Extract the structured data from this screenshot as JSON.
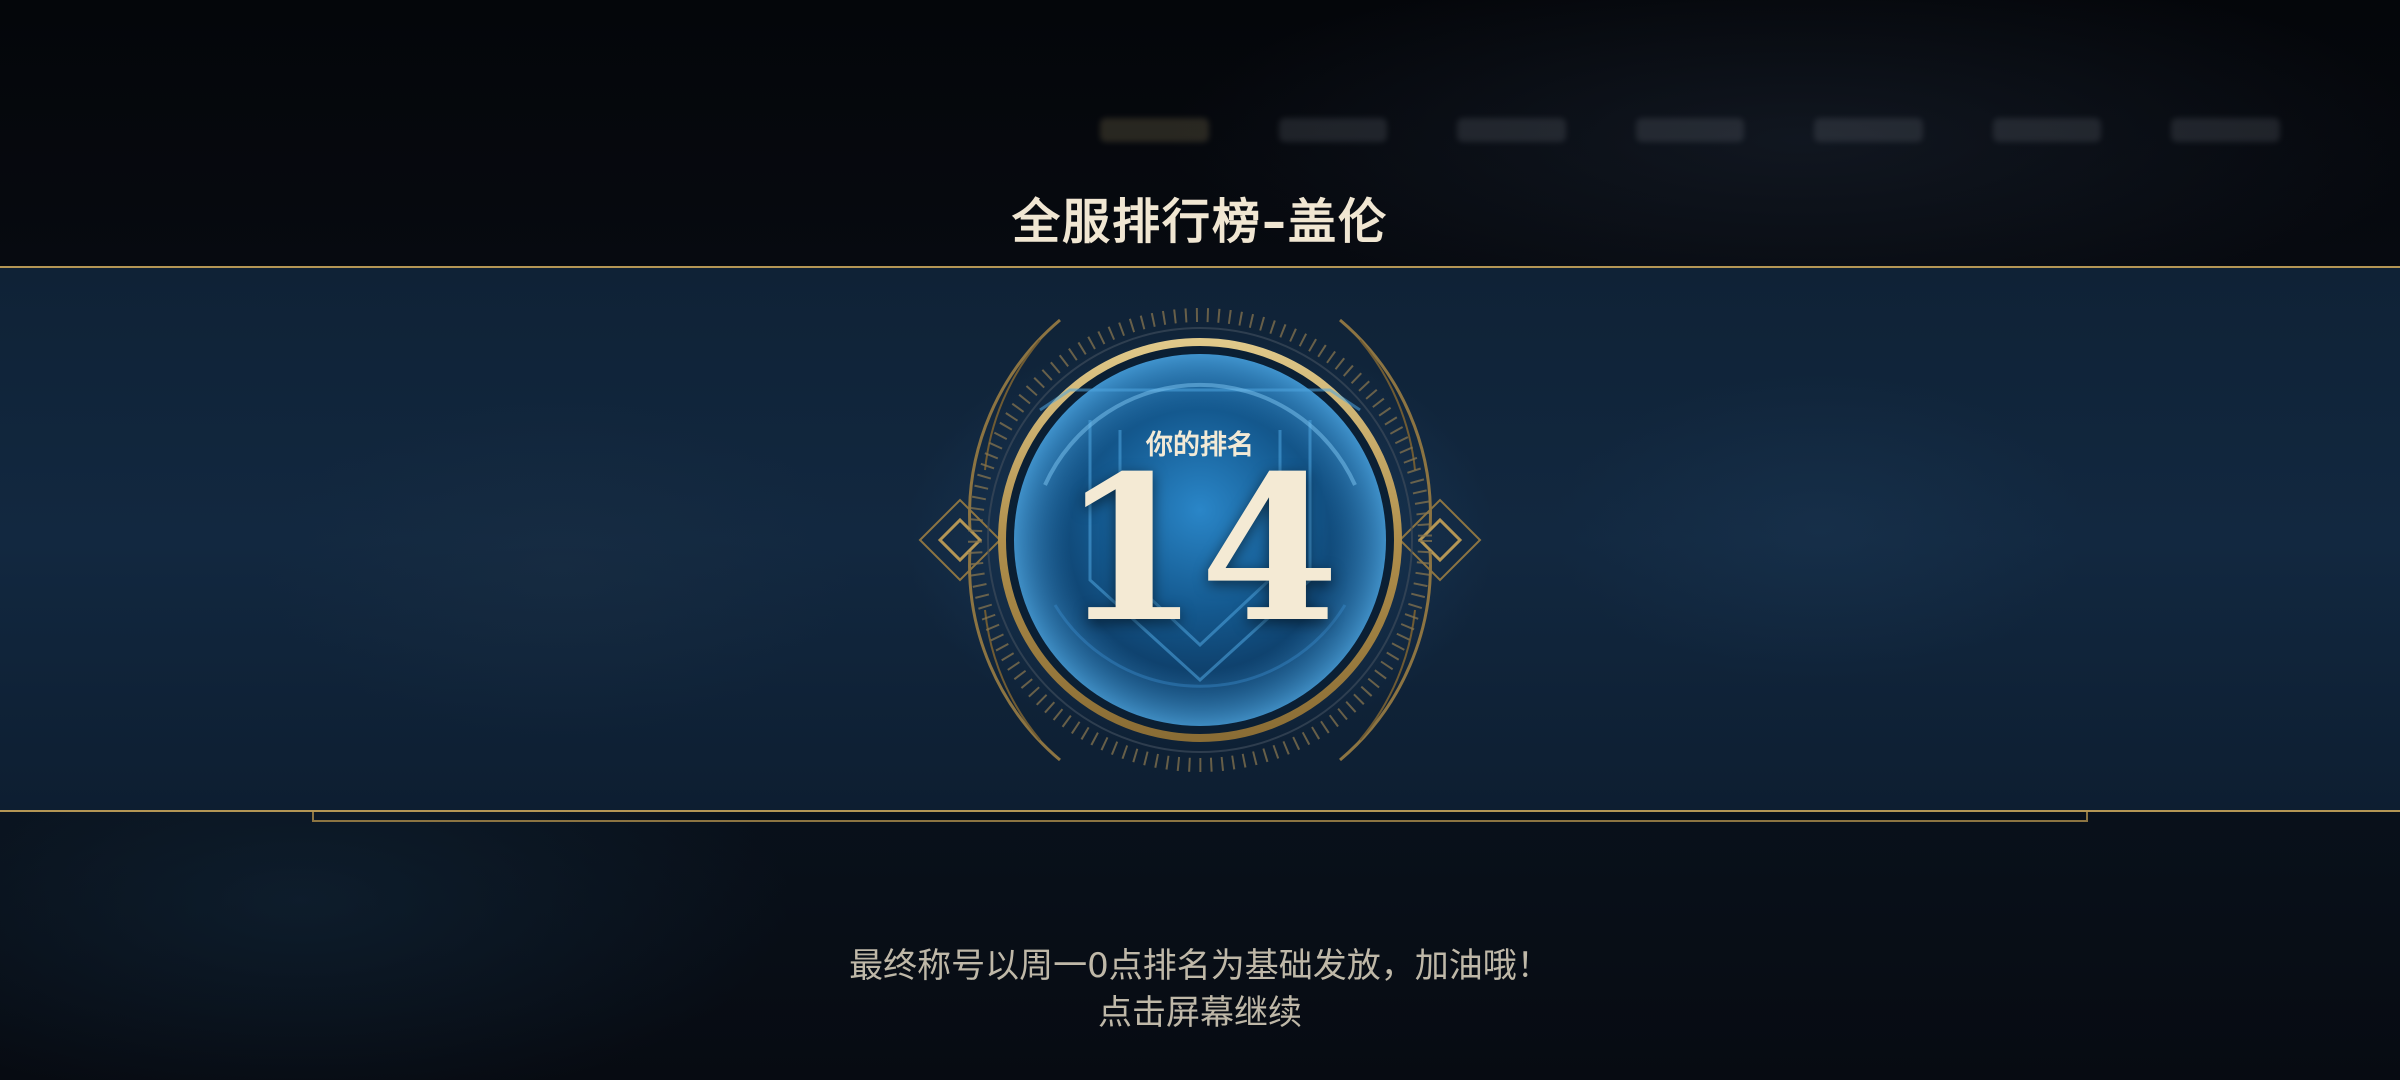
{
  "side_id": "994000",
  "leaderboard": {
    "title": "全服排行榜–盖伦",
    "rank_label": "你的排名",
    "rank_value": "14"
  },
  "footer": {
    "notice": "最终称号以周一0点排名为基础发放，加油哦！",
    "continue_prompt": "点击屏幕继续"
  },
  "colors": {
    "gold": "#b49655",
    "title_text": "#f0e6d2",
    "orb_blue": "#1a6fb0",
    "background": "#05070c"
  }
}
